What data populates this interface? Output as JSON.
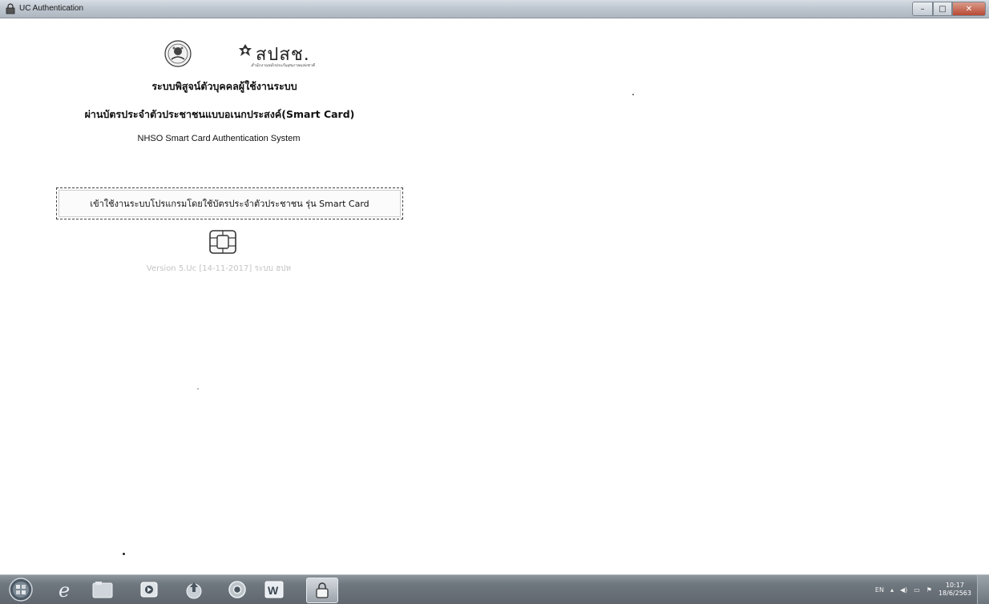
{
  "window": {
    "title": "UC Authentication",
    "controls": {
      "minimize": "–",
      "maximize": "□",
      "close": "✕"
    }
  },
  "logo": {
    "org_short": "สปสช.",
    "org_sub": "สำนักงานหลักประกันสุขภาพแห่งชาติ"
  },
  "header": {
    "line1": "ระบบพิสูจน์ตัวบุคคลผู้ใช้งานระบบ",
    "line2": "ผ่านบัตรประจำตัวประชาชนแบบอเนกประสงค์(Smart Card)",
    "line3": "NHSO Smart Card  Authentication System"
  },
  "login": {
    "button_label": "เข้าใช้งานระบบโปรแกรมโดยใช้บัตรประจำตัวประชาชน รุ่น Smart Card"
  },
  "version_text": "Version 5.Uc [14-11-2017] ระบบ ฮปห",
  "taskbar": {
    "icons": [
      "start-orb-icon",
      "internet-explorer-icon",
      "file-explorer-icon",
      "media-player-icon",
      "uploader-icon",
      "chrome-icon",
      "word-icon",
      "uc-auth-lock-icon"
    ],
    "tray": {
      "language": "EN",
      "time": "10:17",
      "date": "18/6/2563"
    }
  },
  "colors": {
    "titlebar": "#bfc7d0",
    "taskbar": "#6f777f",
    "background": "#ffffff",
    "version_text": "#c4c4c4"
  }
}
